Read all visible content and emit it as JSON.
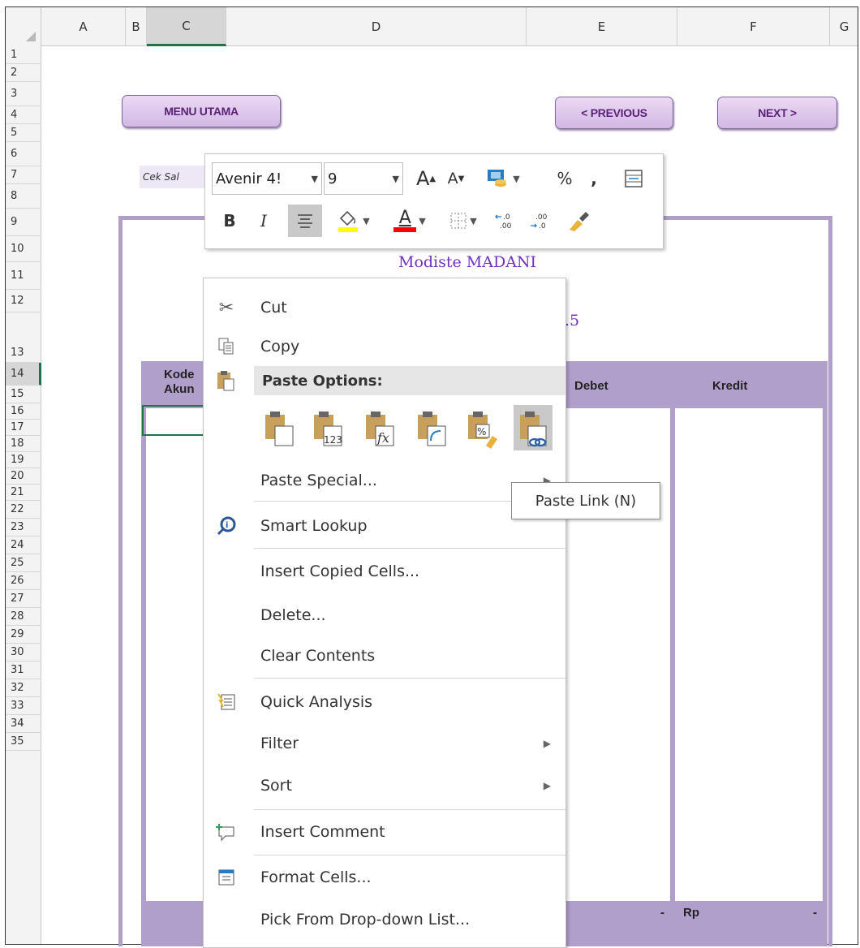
{
  "columns": [
    "A",
    "B",
    "C",
    "D",
    "E",
    "F",
    "G"
  ],
  "rows": [
    "1",
    "2",
    "3",
    "4",
    "5",
    "6",
    "7",
    "8",
    "9",
    "10",
    "11",
    "12",
    "13",
    "14",
    "15",
    "16",
    "17",
    "18",
    "19",
    "20",
    "21",
    "22",
    "23",
    "24",
    "25",
    "26",
    "27",
    "28",
    "29",
    "30",
    "31",
    "32",
    "33",
    "34",
    "35"
  ],
  "selected_cell": "C14",
  "buttons": {
    "menu_utama": "MENU UTAMA",
    "previous": "< PREVIOUS",
    "next": "NEXT >"
  },
  "cek_label": "Cek Sal",
  "report": {
    "company": "Modiste MADANI",
    "period_fragment": ".5"
  },
  "table": {
    "headers": {
      "kode": "Kode",
      "akun": "Akun",
      "debet": "Debet",
      "kredit": "Kredit"
    },
    "footer": {
      "debet_total": "-",
      "rp": "Rp",
      "kredit_total": "-"
    }
  },
  "mini_toolbar": {
    "font_name": "Avenir 4!",
    "font_size": "9",
    "grow_font": "A",
    "shrink_font": "A",
    "percent": "%",
    "comma": ",",
    "bold": "B",
    "italic": "I",
    "font_color_glyph": "A",
    "fill_color": "#ffff00",
    "font_color": "#ff0000"
  },
  "context_menu": {
    "cut": "Cut",
    "copy": "Copy",
    "paste_options": "Paste Options:",
    "paste_special": "Paste Special...",
    "smart_lookup": "Smart Lookup",
    "insert_copied_cells": "Insert Copied Cells...",
    "delete": "Delete...",
    "clear_contents": "Clear Contents",
    "quick_analysis": "Quick Analysis",
    "filter": "Filter",
    "sort": "Sort",
    "insert_comment": "Insert Comment",
    "format_cells": "Format Cells...",
    "pick_from_list": "Pick From Drop-down List..."
  },
  "paste_icon_labels": {
    "values": "123",
    "formulas": "fx",
    "formatting": "%"
  },
  "tooltip": "Paste Link (N)",
  "colors": {
    "accent_purple": "#b19fcb",
    "excel_green": "#217346",
    "title_purple": "#7030c0"
  }
}
